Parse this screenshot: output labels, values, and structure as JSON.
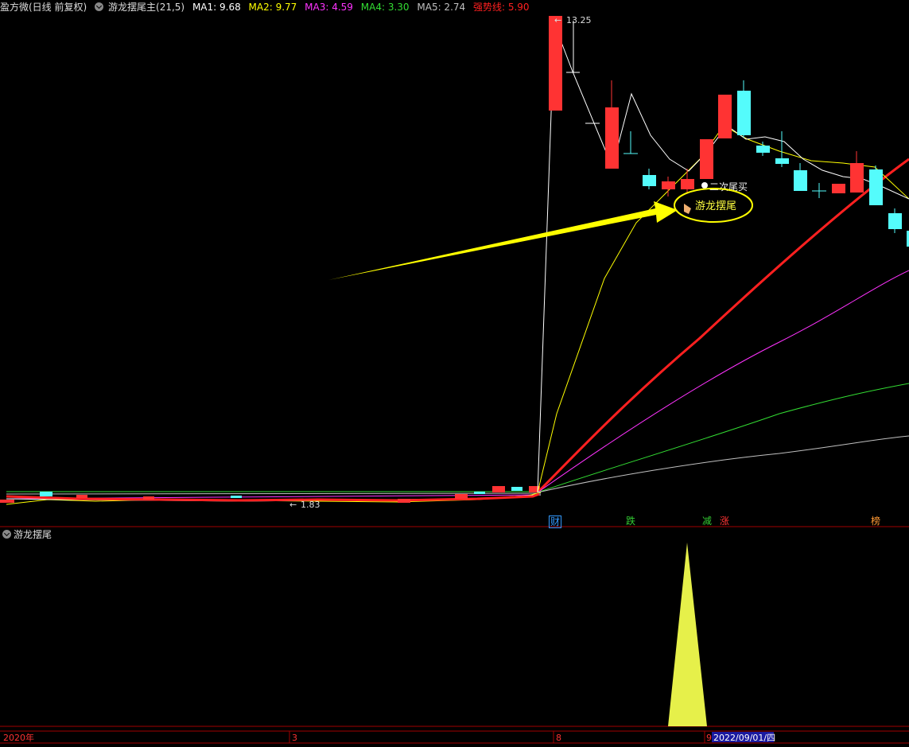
{
  "header": {
    "app_title": "盈方微(日线 前复权)",
    "indicator_name": "游龙摆尾主(21,5)",
    "ma_values": [
      {
        "label": "MA1: 9.68",
        "color": "#ffffff"
      },
      {
        "label": "MA2: 9.77",
        "color": "#ffff00"
      },
      {
        "label": "MA3: 4.59",
        "color": "#ff33ff"
      },
      {
        "label": "MA4: 3.30",
        "color": "#33dd33"
      },
      {
        "label": "MA5: 2.74",
        "color": "#c0c0c0"
      },
      {
        "label": "强势线: 5.90",
        "color": "#ff2020"
      }
    ]
  },
  "annotations": {
    "high_label": "13.25",
    "low_label": "1.83",
    "second_buy": "二次尾买",
    "callout": "游龙摆尾"
  },
  "event_tags": [
    {
      "text": "财",
      "color": "#3399ff"
    },
    {
      "text": "跌",
      "color": "#33cc33"
    },
    {
      "text": "减",
      "color": "#33cc33"
    },
    {
      "text": "涨",
      "color": "#ff3333"
    },
    {
      "text": "榜",
      "color": "#ff9933"
    }
  ],
  "sub_panel": {
    "title": "游龙摆尾"
  },
  "timeline": {
    "labels": [
      "2020年",
      "3",
      "8",
      "9"
    ],
    "current_date": "2022/09/01/四"
  },
  "colors": {
    "up": "#ff3333",
    "down": "#54fcfc",
    "strong_line": "#ff2020",
    "highlight": "#ffff00",
    "spike": "#e6f04a",
    "grid_red": "#a00000"
  }
}
